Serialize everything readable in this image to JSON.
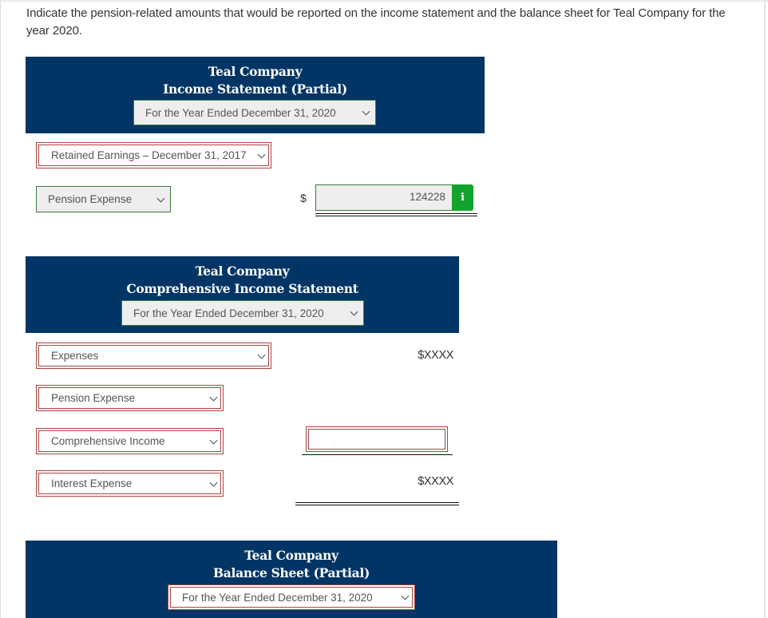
{
  "question": "Indicate the pension-related amounts that would be reported on the income statement and the balance sheet for Teal Company for the year 2020.",
  "income_statement": {
    "company": "Teal Company",
    "title": "Income Statement (Partial)",
    "period_select": "For the Year Ended December 31, 2020",
    "rows": [
      {
        "select": "Retained Earnings – December 31, 2017",
        "state": "incorrect"
      },
      {
        "select": "Pension Expense",
        "state": "correct",
        "currency": "$",
        "amount": "124228",
        "info_icon": "i"
      }
    ]
  },
  "comprehensive_income_statement": {
    "company": "Teal Company",
    "title": "Comprehensive Income Statement",
    "period_select": "For the Year Ended December 31, 2020",
    "rows": [
      {
        "select": "Expenses",
        "state": "incorrect",
        "amount_placeholder": "$XXXX"
      },
      {
        "select": "Pension Expense",
        "state": "incorrect"
      },
      {
        "select": "Comprehensive Income",
        "state": "incorrect",
        "amount": ""
      },
      {
        "select": "Interest Expense",
        "state": "incorrect",
        "amount_placeholder": "$XXXX"
      }
    ]
  },
  "balance_sheet": {
    "company": "Teal Company",
    "title": "Balance Sheet (Partial)",
    "period_select": "For the Year Ended December 31, 2020"
  },
  "colors": {
    "header_bg": "#013565",
    "correct_border": "#3c7a3c",
    "incorrect_border": "#a94442",
    "info_button": "#12a32d"
  }
}
